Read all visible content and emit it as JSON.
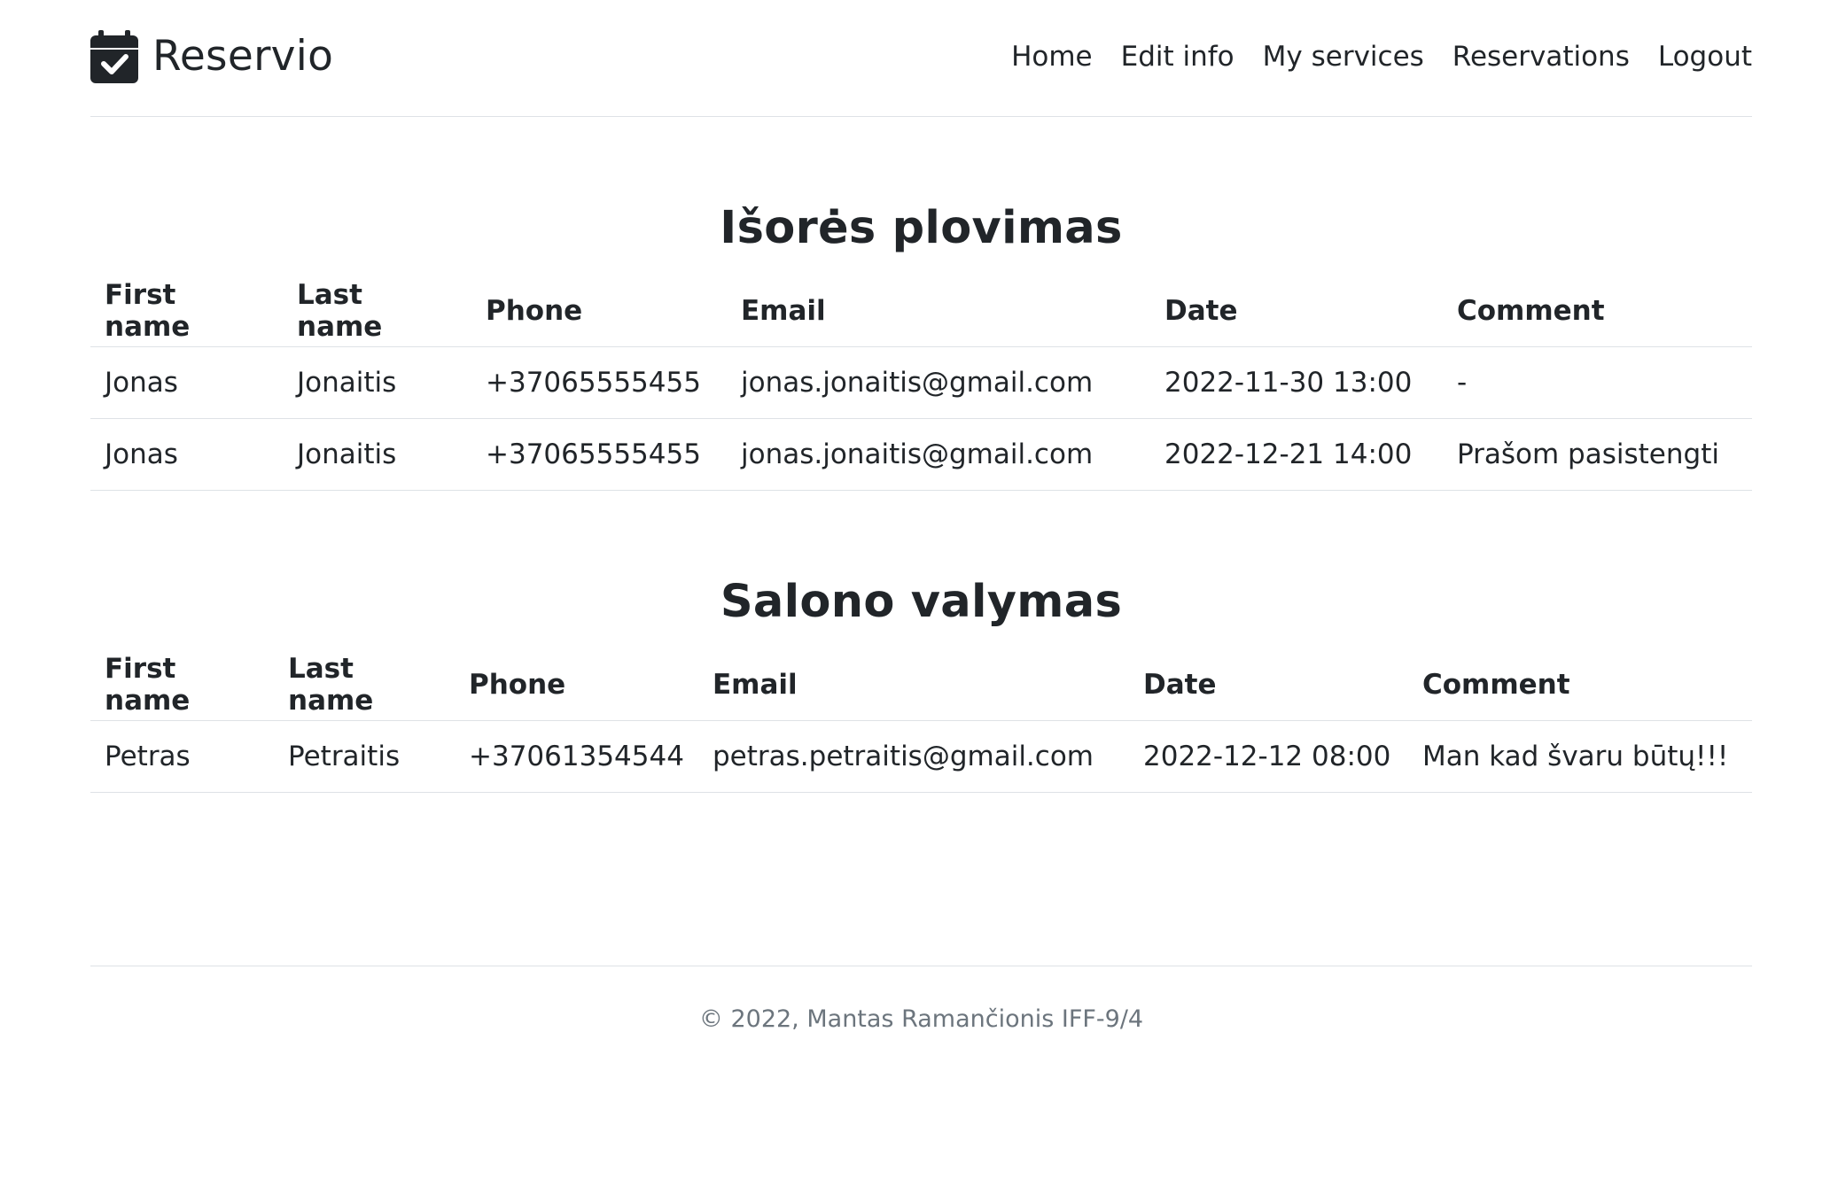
{
  "header": {
    "brand": "Reservio",
    "brand_icon": "calendar-check-icon",
    "nav": [
      "Home",
      "Edit info",
      "My services",
      "Reservations",
      "Logout"
    ]
  },
  "sections": [
    {
      "title": "Išorės plovimas",
      "columns": [
        "First name",
        "Last name",
        "Phone",
        "Email",
        "Date",
        "Comment"
      ],
      "rows": [
        [
          "Jonas",
          "Jonaitis",
          "+37065555455",
          "jonas.jonaitis@gmail.com",
          "2022-11-30 13:00",
          "-"
        ],
        [
          "Jonas",
          "Jonaitis",
          "+37065555455",
          "jonas.jonaitis@gmail.com",
          "2022-12-21 14:00",
          "Prašom pasistengti"
        ]
      ]
    },
    {
      "title": "Salono valymas",
      "columns": [
        "First name",
        "Last name",
        "Phone",
        "Email",
        "Date",
        "Comment"
      ],
      "rows": [
        [
          "Petras",
          "Petraitis",
          "+37061354544",
          "petras.petraitis@gmail.com",
          "2022-12-12 08:00",
          "Man kad švaru būtų!!!"
        ]
      ]
    }
  ],
  "footer": {
    "text": "© 2022, Mantas Ramančionis IFF-9/4"
  }
}
